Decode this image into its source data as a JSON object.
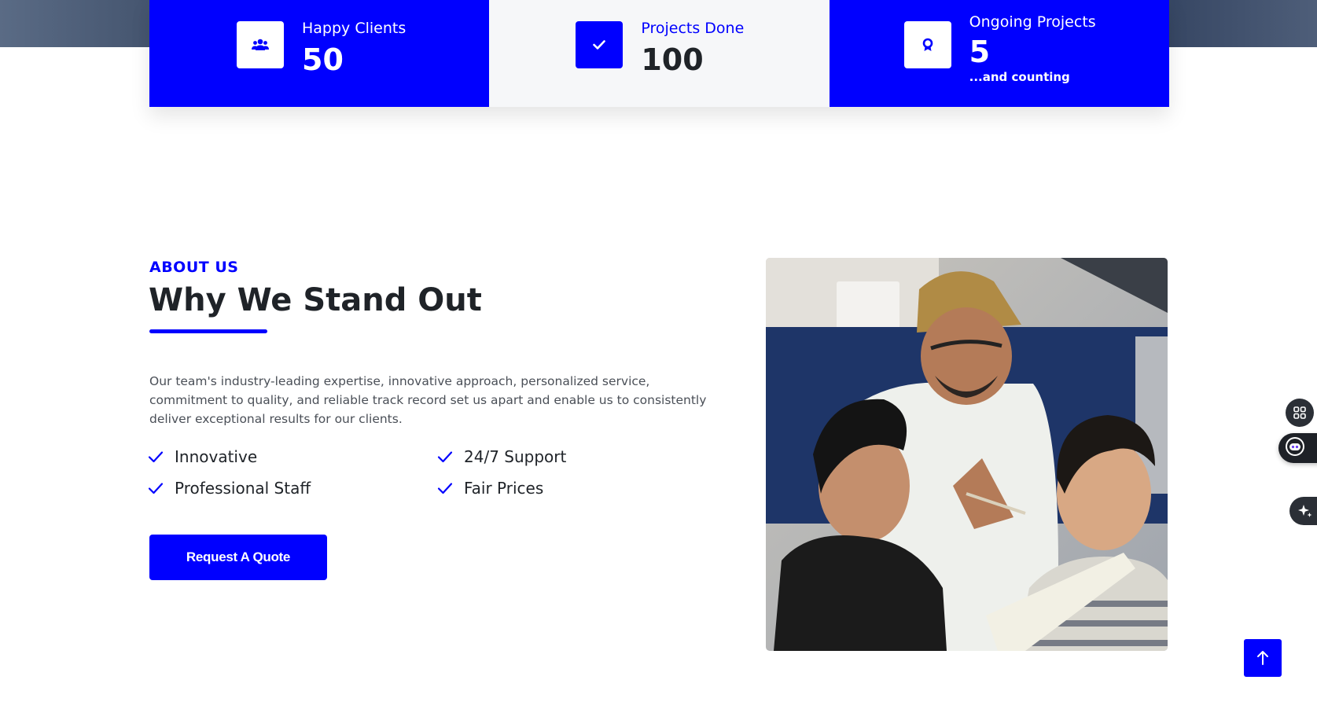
{
  "stats": [
    {
      "label": "Happy Clients",
      "value": "50",
      "icon": "users-icon"
    },
    {
      "label": "Projects Done",
      "value": "100",
      "icon": "check-icon"
    },
    {
      "label": "Ongoing Projects",
      "value": "5",
      "sub": "...and counting",
      "icon": "award-icon"
    }
  ],
  "about": {
    "kicker": "ABOUT US",
    "title": "Why We Stand Out",
    "description": "Our team's industry-leading expertise, innovative approach, personalized service, commitment to quality, and reliable track record set us apart and enable us to consistently deliver exceptional results for our clients.",
    "features": [
      "Innovative",
      "24/7 Support",
      "Professional Staff",
      "Fair Prices"
    ],
    "cta_label": "Request A Quote"
  },
  "colors": {
    "accent": "#0000ff",
    "heading": "#1f2328",
    "body_text": "#4a4f57",
    "stat_light_bg": "#f6f7f9"
  },
  "floating": {
    "dock_icons": [
      "apps-grid-icon",
      "assistant-bot-icon",
      "sparkles-icon"
    ],
    "back_to_top_icon": "arrow-up-icon"
  }
}
